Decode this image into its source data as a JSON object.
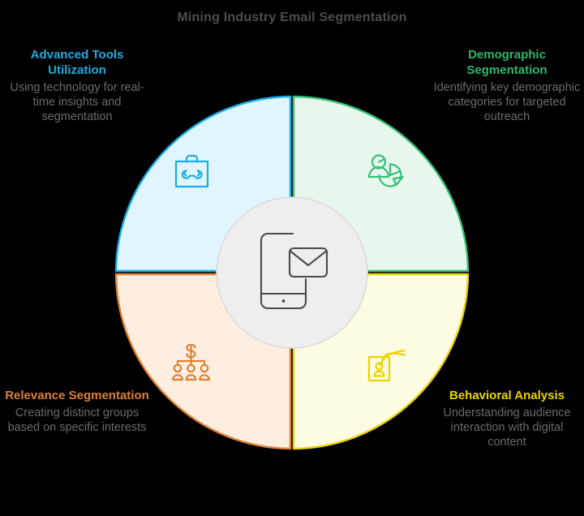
{
  "title": "Mining Industry Email Segmentation",
  "colors": {
    "title_text": "#4d4d4d",
    "body_text": "#6b6b6b",
    "advanced_tools_stroke": "#1cace3",
    "advanced_tools_fill": "#e1f5fe",
    "demographic_stroke": "#37c077",
    "demographic_fill": "#e8f7ee",
    "relevance_stroke": "#de8037",
    "relevance_fill": "#fdeee0",
    "behavioral_stroke": "#ebd400",
    "behavioral_fill": "#fdfbe2",
    "center_circle_fill": "#eeeeee",
    "center_circle_stroke": "#d9d9d9",
    "center_icon_stroke": "#4a4a4a"
  },
  "center": {
    "icon": "smartphone-envelope-icon"
  },
  "segments": [
    {
      "id": "advanced-tools",
      "heading": "Advanced Tools Utilization",
      "heading_line1": "Advanced Tools",
      "heading_line2": "Utilization",
      "description": "Using technology for real-time insights and segmentation",
      "icon": "toolbox-wrench-icon",
      "color": "#1cace3",
      "fill": "#e1f5fe",
      "position": "top-left"
    },
    {
      "id": "demographic",
      "heading": "Demographic Segmentation",
      "heading_line1": "Demographic",
      "heading_line2": "Segmentation",
      "description": "Identifying key demographic categories for targeted outreach",
      "icon": "person-pie-chart-icon",
      "color": "#37c077",
      "fill": "#e8f7ee",
      "position": "top-right"
    },
    {
      "id": "relevance",
      "heading": "Relevance Segmentation",
      "heading_line1": "Relevance",
      "heading_line2": "Segmentation",
      "description": "Creating distinct groups based on specific interests",
      "icon": "dollar-hierarchy-people-icon",
      "color": "#de8037",
      "fill": "#fdeee0",
      "position": "bottom-left"
    },
    {
      "id": "behavioral",
      "heading": "Behavioral Analysis",
      "heading_line1": "Behavioral",
      "heading_line2": "Analysis",
      "description": "Understanding audience interaction with digital content",
      "icon": "hand-tap-profile-card-icon",
      "color": "#ebd400",
      "fill": "#fdfbe2",
      "position": "bottom-right"
    }
  ],
  "chart_data": {
    "type": "pie",
    "subtype": "donut",
    "title": "Mining Industry Email Segmentation",
    "categories": [
      "Advanced Tools Utilization",
      "Demographic Segmentation",
      "Behavioral Analysis",
      "Relevance Segmentation"
    ],
    "values": [
      25,
      25,
      25,
      25
    ],
    "unit": "percent",
    "colors": [
      "#1cace3",
      "#37c077",
      "#ebd400",
      "#de8037"
    ],
    "legend": "none",
    "grid": false,
    "xlabel": "",
    "ylabel": ""
  }
}
